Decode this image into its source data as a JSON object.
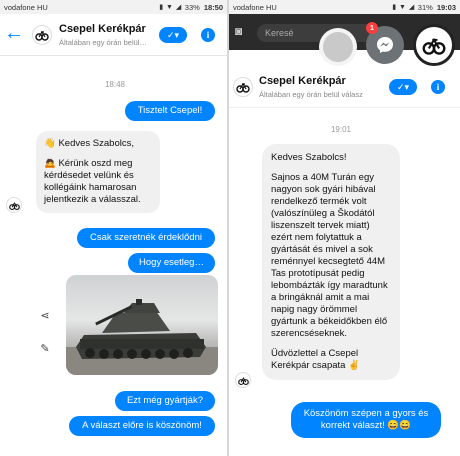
{
  "left": {
    "status": {
      "carrier": "vodafone HU",
      "battery": "33%",
      "time": "18:50"
    },
    "header": {
      "name": "Csepel Kerékpár",
      "subtitle": "Általában egy órán belül…"
    },
    "timestamp": "18:48",
    "messages": {
      "m1": "Tisztelt Csepel!",
      "m2_1": "👋 Kedves Szabolcs,",
      "m2_2": "🙇 Kérünk oszd meg kérdésedet velünk és kollégáink hamarosan jelentkezik a válasszal.",
      "m3": "Csak szeretnék érdeklődni",
      "m4": "Hogy esetleg…",
      "m5": "Ezt még gyártják?",
      "m6": "A választ előre is köszönöm!"
    }
  },
  "right": {
    "status": {
      "carrier": "vodafone HU",
      "battery": "31%",
      "time": "19:03"
    },
    "search_text": "Keresé",
    "notification_count": "1",
    "header": {
      "name": "Csepel Kerékpár",
      "subtitle": "Általában egy órán belül válasz"
    },
    "timestamp": "19:01",
    "messages": {
      "r1_1": "Kedves Szabolcs!",
      "r1_2": "Sajnos a 40M Turán egy nagyon sok gyári hibával rendelkező termék volt (valószínüleg a Škodától liszenszelt tervek miatt) ezért nem folytattuk a gyártását és mivel a sok reménnyel kecsegtető 44M Tas prototípusát pedig lebombázták így maradtunk a bringáknál amit a mai napig nagy örömmel gyártunk a békeidőkben élő szerencséseknek.",
      "r1_3": "Üdvözlettel a Csepel Kerékpár csapata ✌",
      "r2": "Köszönöm szépen a gyors és korrekt választ! 😄😄"
    }
  },
  "icons": [
    "back-arrow-icon",
    "bicycle-logo-icon",
    "thumbs-up-icon",
    "info-icon",
    "share-icon",
    "edit-icon",
    "camera-icon",
    "messenger-icon"
  ],
  "colors": {
    "accent": "#0084ff",
    "bubble_in": "#f1f0f0",
    "text": "#111111"
  }
}
